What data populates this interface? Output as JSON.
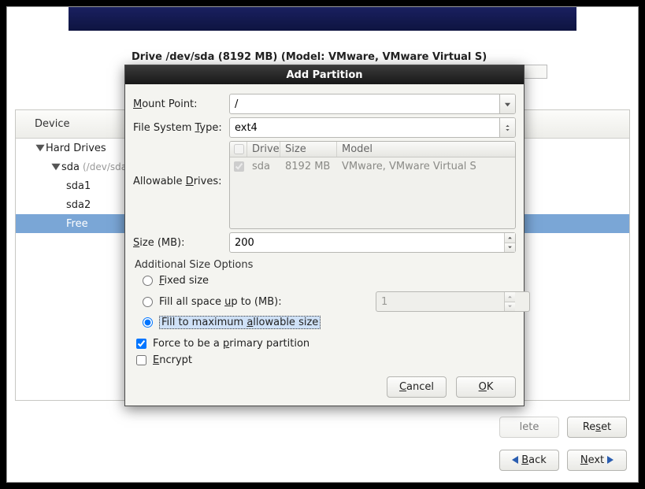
{
  "drive_header": "Drive /dev/sda (8192 MB) (Model: VMware, VMware Virtual S)",
  "tree": {
    "header_device": "Device",
    "hard_drives": "Hard Drives",
    "sda": "sda",
    "sda_path": "(/dev/sda)",
    "sda1": "sda1",
    "sda2": "sda2",
    "free": "Free"
  },
  "bottom": {
    "delete": "lete",
    "reset_pre": "Re",
    "reset_u": "s",
    "reset_post": "et"
  },
  "nav": {
    "back_u": "B",
    "back_post": "ack",
    "next_u": "N",
    "next_post": "ext"
  },
  "modal": {
    "title": "Add Partition",
    "mount_point": {
      "u": "M",
      "rest": "ount Point:"
    },
    "mount_value": "/",
    "fs_type": {
      "pre": "File System ",
      "u": "T",
      "post": "ype:"
    },
    "fs_value": "ext4",
    "allowable": {
      "pre": "Allowable ",
      "u": "D",
      "post": "rives:"
    },
    "drives_table": {
      "hdr_drive": "Drive",
      "hdr_size": "Size",
      "hdr_model": "Model",
      "drive": "sda",
      "size": "8192 MB",
      "model": "VMware, VMware Virtual S"
    },
    "size_label": {
      "u": "S",
      "rest": "ize (MB):"
    },
    "size_value": "200",
    "group": "Additional Size Options",
    "fixed": {
      "u": "F",
      "rest": "ixed size"
    },
    "fill_up": {
      "pre": "Fill all space ",
      "u": "u",
      "post": "p to (MB):"
    },
    "fill_up_value": "1",
    "fill_max": {
      "pre": "Fill to maximum ",
      "u": "a",
      "post": "llowable size"
    },
    "primary": {
      "pre": "Force to be a ",
      "u": "p",
      "post": "rimary partition"
    },
    "encrypt": {
      "u": "E",
      "rest": "ncrypt"
    },
    "cancel": {
      "u": "C",
      "rest": "ancel"
    },
    "ok": {
      "u": "O",
      "rest": "K"
    }
  }
}
